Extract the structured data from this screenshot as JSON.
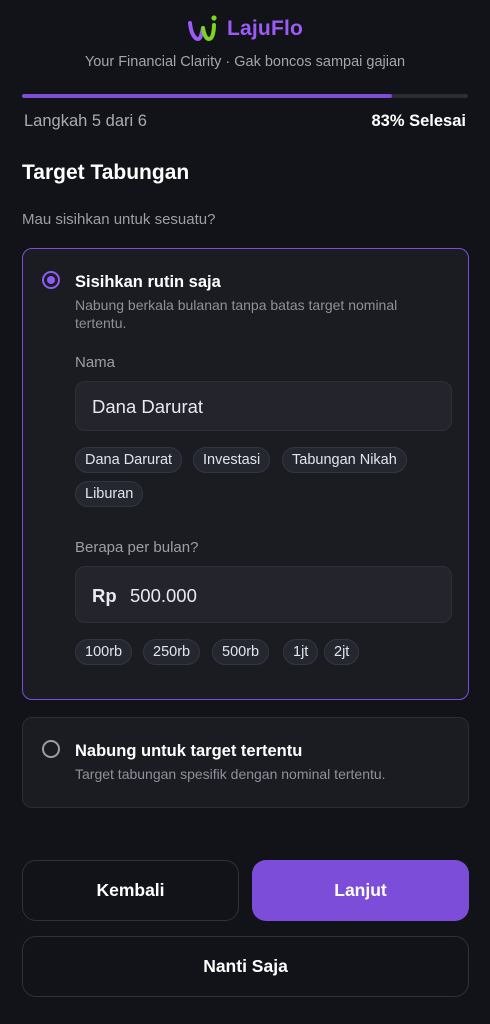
{
  "brand": {
    "name": "LajuFlo",
    "tagline": "Your Financial Clarity · Gak boncos sampai gajian",
    "colors": {
      "accent": "#7c4dd9",
      "logo_green": "#7ed321",
      "logo_purple": "#9b5cf6"
    }
  },
  "progress": {
    "step_label": "Langkah 5 dari 6",
    "percent_label": "83% Selesai",
    "fraction": 0.83
  },
  "section": {
    "title": "Target Tabungan",
    "subtitle": "Mau sisihkan untuk sesuatu?"
  },
  "option_routine": {
    "title": "Sisihkan rutin saja",
    "description": "Nabung berkala bulanan tanpa batas target nominal tertentu.",
    "selected": true,
    "name_label": "Nama",
    "name_value": "Dana Darurat",
    "name_chips": [
      "Dana Darurat",
      "Investasi",
      "Tabungan Nikah",
      "Liburan"
    ],
    "amount_label": "Berapa per bulan?",
    "currency": "Rp",
    "amount_value": "500.000",
    "amount_chips": [
      "100rb",
      "250rb",
      "500rb",
      "1jt",
      "2jt"
    ]
  },
  "option_target": {
    "title": "Nabung untuk target tertentu",
    "description": "Target tabungan spesifik dengan nominal tertentu.",
    "selected": false
  },
  "buttons": {
    "back": "Kembali",
    "next": "Lanjut",
    "later": "Nanti Saja"
  }
}
